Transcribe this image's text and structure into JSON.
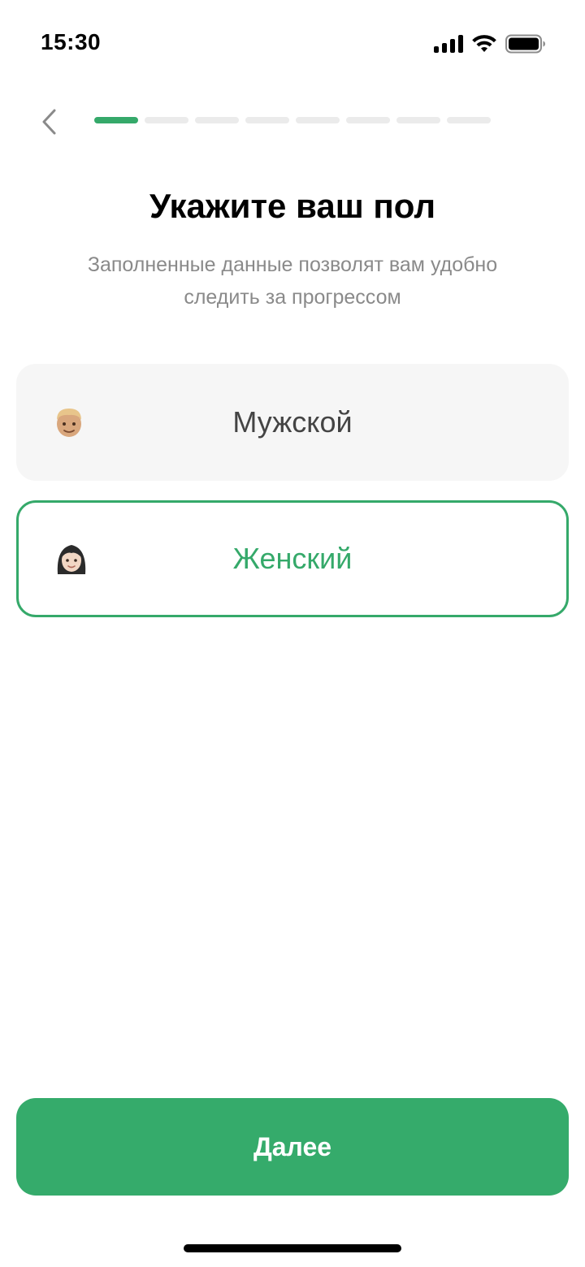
{
  "status_bar": {
    "time": "15:30",
    "icons": [
      "signal-icon",
      "wifi-icon",
      "battery-icon"
    ]
  },
  "nav": {
    "back_icon": "chevron-left-icon",
    "progress": {
      "total_steps": 8,
      "current_step": 1
    }
  },
  "header": {
    "title": "Укажите ваш пол",
    "subtitle": "Заполненные данные позволят вам удобно следить за прогрессом"
  },
  "options": [
    {
      "label": "Мужской",
      "icon": "man-emoji-icon",
      "selected": false
    },
    {
      "label": "Женский",
      "icon": "woman-emoji-icon",
      "selected": true
    }
  ],
  "actions": {
    "next_label": "Далее"
  },
  "colors": {
    "accent": "#35a96a",
    "option_bg": "#f6f6f6",
    "progress_inactive": "#ebebeb",
    "subtitle": "#8a8a8a"
  }
}
